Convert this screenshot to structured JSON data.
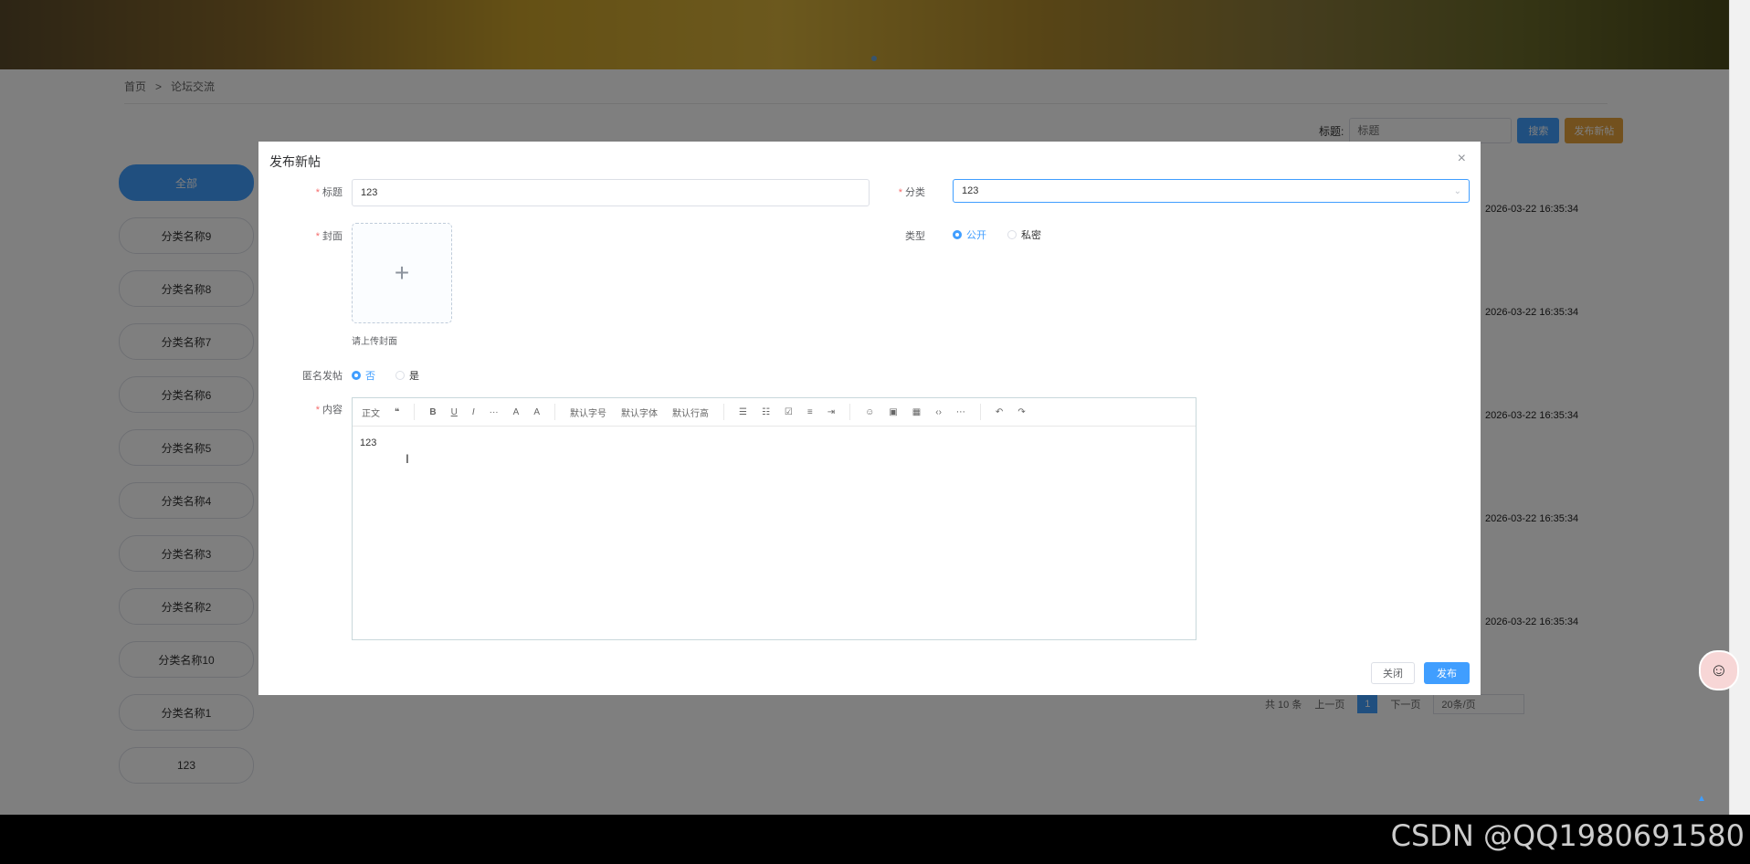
{
  "breadcrumb": {
    "home": "首页",
    "sep": ">",
    "current": "论坛交流"
  },
  "search": {
    "label": "标题:",
    "placeholder": "标题",
    "search_btn": "搜索",
    "publish_btn": "发布新帖"
  },
  "categories": [
    "全部",
    "分类名称9",
    "分类名称8",
    "分类名称7",
    "分类名称6",
    "分类名称5",
    "分类名称4",
    "分类名称3",
    "分类名称2",
    "分类名称10",
    "分类名称1",
    "123"
  ],
  "post_times": [
    "2026-03-22 16:35:34",
    "2026-03-22 16:35:34",
    "2026-03-22 16:35:34",
    "2026-03-22 16:35:34",
    "2026-03-22 16:35:34"
  ],
  "pager": {
    "total": "共 10 条",
    "prev": "上一页",
    "current": "1",
    "next": "下一页",
    "size": "20条/页"
  },
  "modal": {
    "title": "发布新帖",
    "close_icon": "×",
    "title_label": "标题",
    "title_value": "123",
    "category_label": "分类",
    "category_value": "123",
    "cover_label": "封面",
    "upload_tip": "请上传封面",
    "type_label": "类型",
    "type_public": "公开",
    "type_private": "私密",
    "anon_label": "匿名发帖",
    "anon_no": "否",
    "anon_yes": "是",
    "content_label": "内容",
    "content_value": "123",
    "close_btn": "关闭",
    "submit_btn": "发布"
  },
  "toolbar": {
    "heading": "正文",
    "quote": "❝",
    "bold": "B",
    "underline": "U",
    "italic": "I",
    "more": "···",
    "color": "A",
    "bgcolor": "A",
    "fontsize": "默认字号",
    "fontfamily": "默认字体",
    "lineheight": "默认行高",
    "undo": "↶",
    "redo": "↷"
  },
  "watermark": "CSDN @QQ1980691580"
}
